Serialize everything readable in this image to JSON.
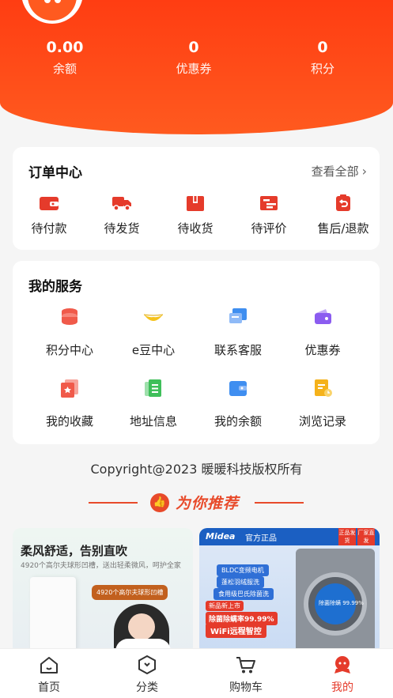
{
  "stats": [
    {
      "value": "0.00",
      "label": "余额"
    },
    {
      "value": "0",
      "label": "优惠券"
    },
    {
      "value": "0",
      "label": "积分"
    }
  ],
  "order": {
    "title": "订单中心",
    "view_all": "查看全部",
    "items": [
      {
        "label": "待付款",
        "icon": "wallet-icon"
      },
      {
        "label": "待发货",
        "icon": "truck-icon"
      },
      {
        "label": "待收货",
        "icon": "package-icon"
      },
      {
        "label": "待评价",
        "icon": "review-icon"
      },
      {
        "label": "售后/退款",
        "icon": "refund-icon"
      }
    ]
  },
  "services": {
    "title": "我的服务",
    "items": [
      {
        "label": "积分中心",
        "icon": "coin-stack-icon",
        "color": "#f05a4a"
      },
      {
        "label": "e豆中心",
        "icon": "bean-icon",
        "color": "#f5c21b"
      },
      {
        "label": "联系客服",
        "icon": "chat-icon",
        "color": "#3f8ef0"
      },
      {
        "label": "优惠券",
        "icon": "coupon-wallet-icon",
        "color": "#8b5cf0"
      },
      {
        "label": "我的收藏",
        "icon": "favorite-icon",
        "color": "#f05a4a"
      },
      {
        "label": "地址信息",
        "icon": "address-icon",
        "color": "#3fbf5a"
      },
      {
        "label": "我的余额",
        "icon": "balance-wallet-icon",
        "color": "#3f8ef0"
      },
      {
        "label": "浏览记录",
        "icon": "history-icon",
        "color": "#f5b21b"
      }
    ]
  },
  "copyright": "Copyright@2023 暖暖科技版权所有",
  "recommend": {
    "title": "为你推荐",
    "products": [
      {
        "headline": "柔风舒适，告别直吹",
        "subline": "4920个高尔夫球形凹槽，送出轻柔微风，呵护全家",
        "tag": "4920个高尔夫球形凹槽"
      },
      {
        "brand": "Midea",
        "official": "官方正品",
        "corner1": "正品发货",
        "corner2": "厂家直发",
        "features": [
          "BLDC变频电机",
          "蓬松羽绒服洗",
          "食用级巴氏除菌洗"
        ],
        "promo1": "新品新上市",
        "promo2": "除菌除螨率99.99%",
        "promo3": "WiFi远程智控",
        "door_text": "除菌除螨 99.99%"
      }
    ]
  },
  "nav": [
    {
      "label": "首页",
      "icon": "home-icon",
      "active": false
    },
    {
      "label": "分类",
      "icon": "category-icon",
      "active": false
    },
    {
      "label": "购物车",
      "icon": "cart-icon",
      "active": false
    },
    {
      "label": "我的",
      "icon": "profile-icon",
      "active": true
    }
  ],
  "colors": {
    "brand": "#ff4a17",
    "active": "#e53b2b"
  }
}
